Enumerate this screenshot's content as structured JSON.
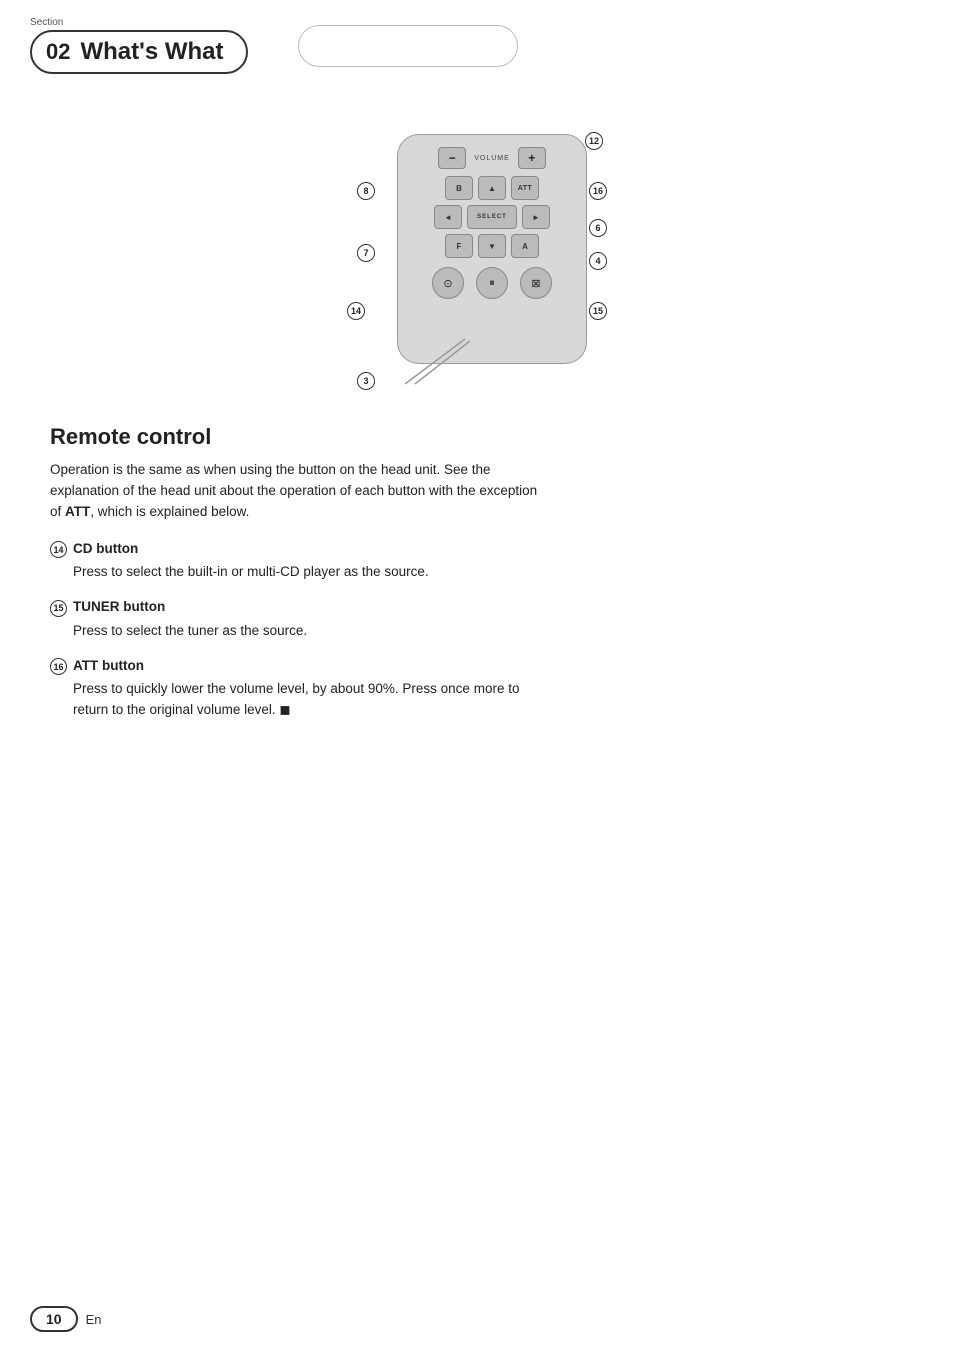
{
  "header": {
    "section_label": "Section",
    "section_number": "02",
    "title": "What's What",
    "right_pill_text": ""
  },
  "remote": {
    "volume_minus": "−",
    "volume_label": "VOLUME",
    "volume_plus": "+",
    "btn_b": "B",
    "btn_up": "▲",
    "btn_att": "ATT",
    "btn_left": "◄",
    "btn_select": "SELECT",
    "btn_right": "►",
    "btn_f": "F",
    "btn_down": "▼",
    "btn_a": "A",
    "btn_cd": "⊙",
    "btn_pause": "⏸",
    "btn_tuner": "⊠"
  },
  "callouts": [
    {
      "num": "12",
      "pos": "top-right"
    },
    {
      "num": "16",
      "pos": "right-top"
    },
    {
      "num": "6",
      "pos": "right-mid"
    },
    {
      "num": "4",
      "pos": "right-bot"
    },
    {
      "num": "15",
      "pos": "right-bottom"
    },
    {
      "num": "8",
      "pos": "left-top"
    },
    {
      "num": "7",
      "pos": "left-mid"
    },
    {
      "num": "14",
      "pos": "left-bot"
    },
    {
      "num": "3",
      "pos": "bottom-left"
    }
  ],
  "content": {
    "section_title": "Remote control",
    "intro_text": "Operation is the same as when using the button on the head unit. See the explanation of the head unit about the operation of each button with the exception of ATT, which is explained below.",
    "items": [
      {
        "num": "14",
        "title": "CD button",
        "body": "Press to select the built-in or multi-CD player as the source."
      },
      {
        "num": "15",
        "title": "TUNER button",
        "body": "Press to select the tuner as the source."
      },
      {
        "num": "16",
        "title": "ATT button",
        "body": "Press to quickly lower the volume level, by about 90%. Press once more to return to the original volume level. ◼"
      }
    ]
  },
  "footer": {
    "page_number": "10",
    "language": "En"
  }
}
